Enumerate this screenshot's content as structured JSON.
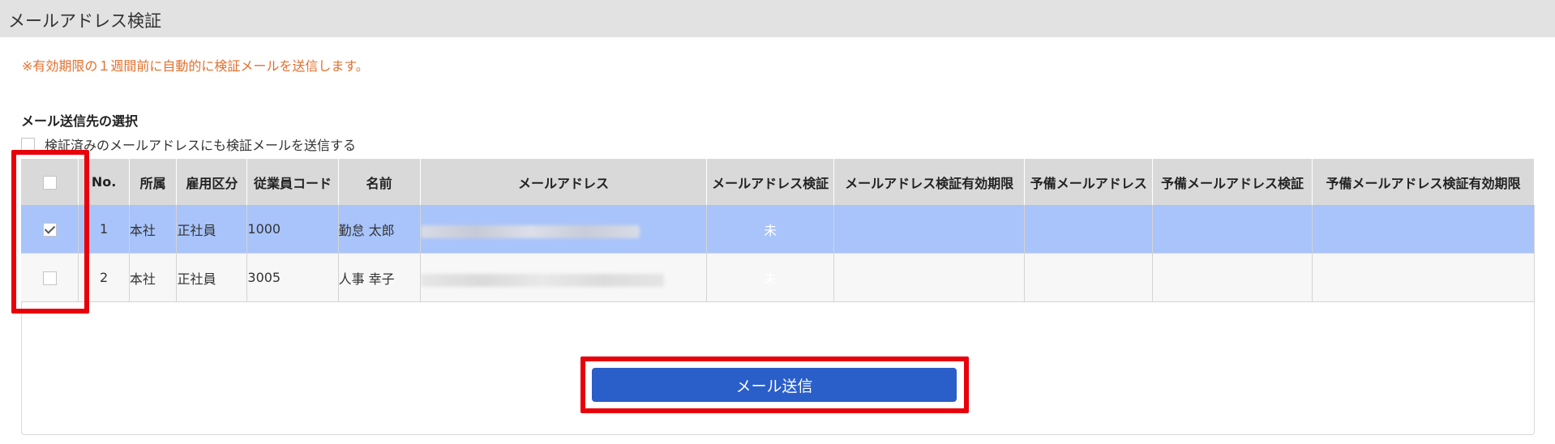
{
  "header": {
    "title": "メールアドレス検証"
  },
  "notice": "※有効期限の１週間前に自動的に検証メールを送信します。",
  "selection": {
    "section_title": "メール送信先の選択",
    "include_verified_label": "検証済みのメールアドレスにも検証メールを送信する",
    "include_verified_checked": false
  },
  "table": {
    "columns": [
      "",
      "No.",
      "所属",
      "雇用区分",
      "従業員コード",
      "名前",
      "メールアドレス",
      "メールアドレス検証",
      "メールアドレス検証有効期限",
      "予備メールアドレス",
      "予備メールアドレス検証",
      "予備メールアドレス検証有効期限"
    ],
    "rows": [
      {
        "checked": true,
        "no": "1",
        "affiliation": "本社",
        "employment_type": "正社員",
        "employee_code": "1000",
        "name": "勤怠 太郎",
        "email": "",
        "email_verification": "未",
        "email_verification_expiry": "",
        "backup_email": "",
        "backup_email_verification": "",
        "backup_email_verification_expiry": ""
      },
      {
        "checked": false,
        "no": "2",
        "affiliation": "本社",
        "employment_type": "正社員",
        "employee_code": "3005",
        "name": "人事 幸子",
        "email": "",
        "email_verification": "未",
        "email_verification_expiry": "",
        "backup_email": "",
        "backup_email_verification": "",
        "backup_email_verification_expiry": ""
      }
    ]
  },
  "send_button_label": "メール送信",
  "colors": {
    "header_bg": "#e2e2e2",
    "notice": "#e2702f",
    "selected_row": "#a8c4fb",
    "unverified_badge": "#a6142b",
    "button": "#2a5ec9",
    "highlight": "#e8000b"
  }
}
